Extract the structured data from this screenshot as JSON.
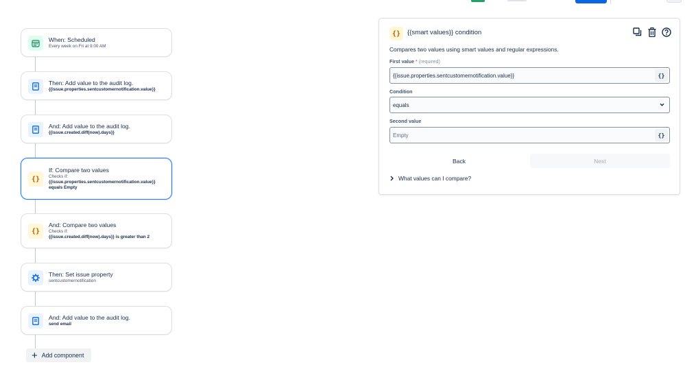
{
  "flow": {
    "cards": [
      {
        "title": "When: Scheduled",
        "lines": [
          "Every week on Fri at 9:00 AM"
        ],
        "icon": "calendar-icon"
      },
      {
        "title": "Then: Add value to the audit log.",
        "lines": [
          "{{issue.properties.sentcustomernotification.value}}"
        ],
        "icon": "document-icon"
      },
      {
        "title": "And: Add value to the audit log.",
        "lines": [
          "{{issue.created.diff(now).days}}"
        ],
        "icon": "document-icon"
      },
      {
        "title": "If: Compare two values",
        "lines": [
          "Checks if:",
          "{{issue.properties.sentcustomernotification.value}}",
          "equals Empty"
        ],
        "icon": "braces-icon"
      },
      {
        "title": "And: Compare two values",
        "lines": [
          "Checks if:",
          "{{issue.created.diff(now).days}} is greater than 2"
        ],
        "icon": "braces-icon"
      },
      {
        "title": "Then: Set issue property",
        "lines": [
          "sentcustomernotification"
        ],
        "icon": "gear-icon"
      },
      {
        "title": "And: Add value to the audit log.",
        "lines": [
          "send email"
        ],
        "icon": "document-icon"
      }
    ],
    "add_component": "Add component"
  },
  "panel": {
    "icon_glyph": "{}",
    "title": "{{smart values}} condition",
    "description": "Compares two values using smart values and regular expressions.",
    "first_value_label": "First value",
    "required_marker": "*",
    "required_text": "(required)",
    "first_value": "{{issue.properties.sentcustomernotification.value}}",
    "condition_label": "Condition",
    "condition_value": "equals",
    "second_value_label": "Second value",
    "second_value_placeholder": "Empty",
    "smart_button": "{}",
    "back": "Back",
    "next": "Next",
    "expander": "What values can I compare?"
  },
  "colors": {
    "accent": "#1d7afc",
    "primary_button": "#0c66e4",
    "trigger_green": "#1f845a",
    "condition_yellow": "#b65c02"
  }
}
